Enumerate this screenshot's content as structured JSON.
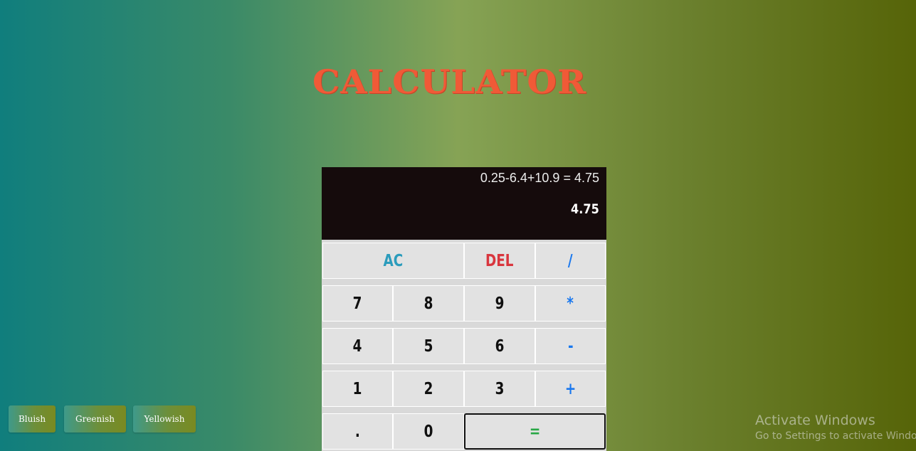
{
  "title": "CALCULATOR",
  "display": {
    "expression": "0.25-6.4+10.9 = 4.75",
    "result": "4.75"
  },
  "keys": {
    "ac": "AC",
    "del": "DEL",
    "divide": "/",
    "seven": "7",
    "eight": "8",
    "nine": "9",
    "multiply": "*",
    "four": "4",
    "five": "5",
    "six": "6",
    "subtract": "-",
    "one": "1",
    "two": "2",
    "three": "3",
    "add": "+",
    "dot": ".",
    "zero": "0",
    "equals": "="
  },
  "themes": [
    "Bluish",
    "Greenish",
    "Yellowish"
  ],
  "watermark": {
    "line1": "Activate Windows",
    "line2": "Go to Settings to activate Windows."
  },
  "colors": {
    "title": "#f05a37",
    "operator": "#1a78ee",
    "ac": "#2b9cbc",
    "delete": "#d9363e",
    "equals": "#28a745",
    "display_bg": "#150b0c"
  }
}
